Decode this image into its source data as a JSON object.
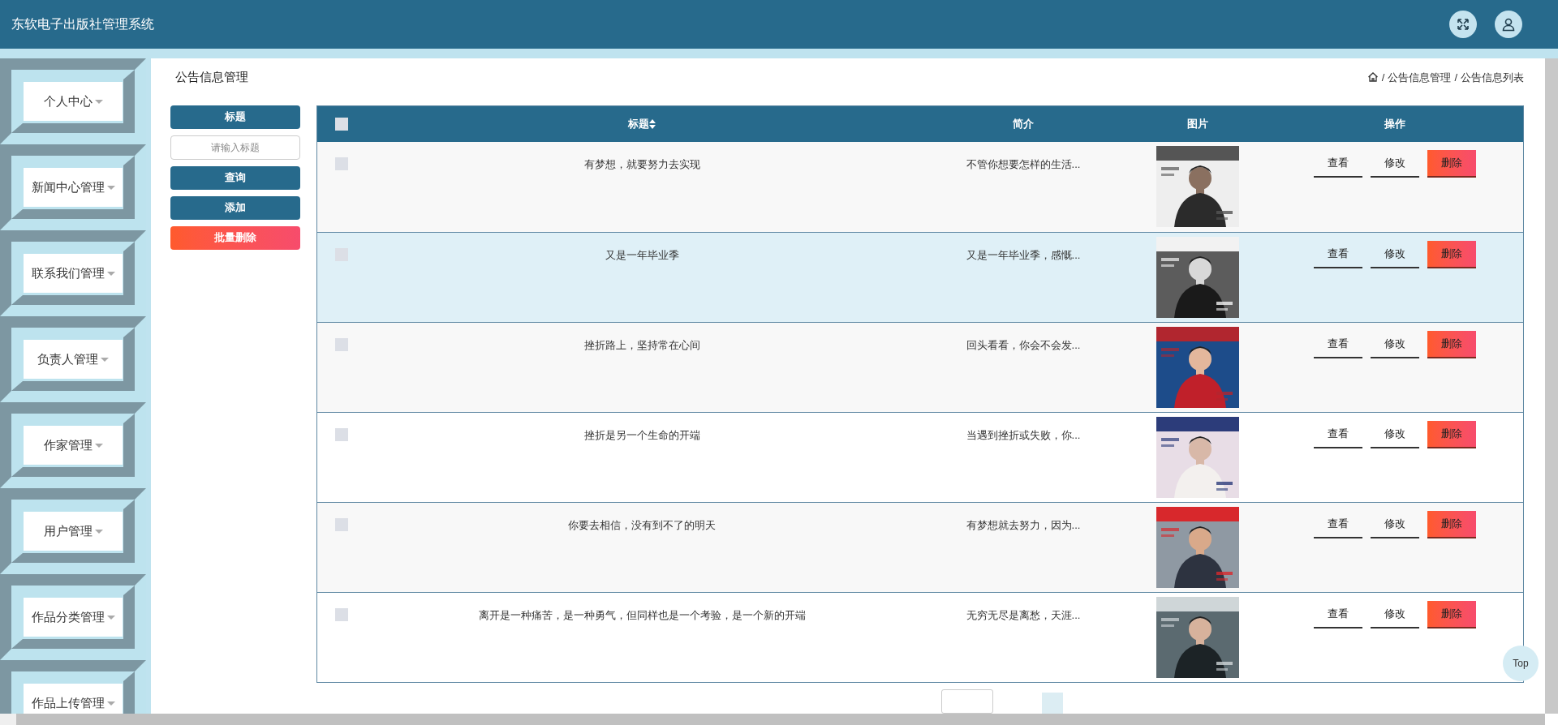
{
  "header": {
    "title": "东软电子出版社管理系统"
  },
  "sidebar": {
    "items": [
      {
        "label": "个人中心"
      },
      {
        "label": "新闻中心管理"
      },
      {
        "label": "联系我们管理"
      },
      {
        "label": "负责人管理"
      },
      {
        "label": "作家管理"
      },
      {
        "label": "用户管理"
      },
      {
        "label": "作品分类管理"
      },
      {
        "label": "作品上传管理"
      }
    ]
  },
  "page": {
    "title": "公告信息管理",
    "breadcrumb": [
      "公告信息管理",
      "公告信息列表"
    ],
    "separator": "/"
  },
  "filter": {
    "label": "标题",
    "placeholder": "请输入标题",
    "buttons": [
      {
        "label": "查询",
        "kind": "primary"
      },
      {
        "label": "添加",
        "kind": "primary"
      },
      {
        "label": "批量删除",
        "kind": "danger"
      }
    ]
  },
  "table": {
    "columns": [
      {
        "label": "标题",
        "sortable": true
      },
      {
        "label": "简介",
        "sortable": false
      },
      {
        "label": "图片",
        "sortable": false
      },
      {
        "label": "操作",
        "sortable": false
      }
    ],
    "all_checked": false,
    "rows": [
      {
        "title": "有梦想，就要努力去实现",
        "intro": "不管你想要怎样的生活...",
        "selected": false,
        "checked": false,
        "actions": [
          {
            "label": "查看",
            "kind": "link"
          },
          {
            "label": "修改",
            "kind": "link"
          },
          {
            "label": "删除",
            "kind": "danger"
          }
        ]
      },
      {
        "title": "又是一年毕业季",
        "intro": "又是一年毕业季，感慨...",
        "selected": true,
        "checked": false,
        "actions": [
          {
            "label": "查看",
            "kind": "link"
          },
          {
            "label": "修改",
            "kind": "link"
          },
          {
            "label": "删除",
            "kind": "danger"
          }
        ]
      },
      {
        "title": "挫折路上，坚持常在心间",
        "intro": "回头看看，你会不会发...",
        "selected": false,
        "checked": false,
        "actions": [
          {
            "label": "查看",
            "kind": "link"
          },
          {
            "label": "修改",
            "kind": "link"
          },
          {
            "label": "删除",
            "kind": "danger"
          }
        ]
      },
      {
        "title": "挫折是另一个生命的开端",
        "intro": "当遇到挫折或失败，你...",
        "selected": false,
        "checked": false,
        "actions": [
          {
            "label": "查看",
            "kind": "link"
          },
          {
            "label": "修改",
            "kind": "link"
          },
          {
            "label": "删除",
            "kind": "danger"
          }
        ]
      },
      {
        "title": "你要去相信，没有到不了的明天",
        "intro": "有梦想就去努力，因为...",
        "selected": false,
        "checked": false,
        "actions": [
          {
            "label": "查看",
            "kind": "link"
          },
          {
            "label": "修改",
            "kind": "link"
          },
          {
            "label": "删除",
            "kind": "danger"
          }
        ]
      },
      {
        "title": "离开是一种痛苦，是一种勇气，但同样也是一个考验，是一个新的开端",
        "intro": "无穷无尽是离愁，天涯...",
        "selected": false,
        "checked": false,
        "actions": [
          {
            "label": "查看",
            "kind": "link"
          },
          {
            "label": "修改",
            "kind": "link"
          },
          {
            "label": "删除",
            "kind": "danger"
          }
        ]
      }
    ]
  },
  "back_to_top": {
    "label": "Top"
  }
}
